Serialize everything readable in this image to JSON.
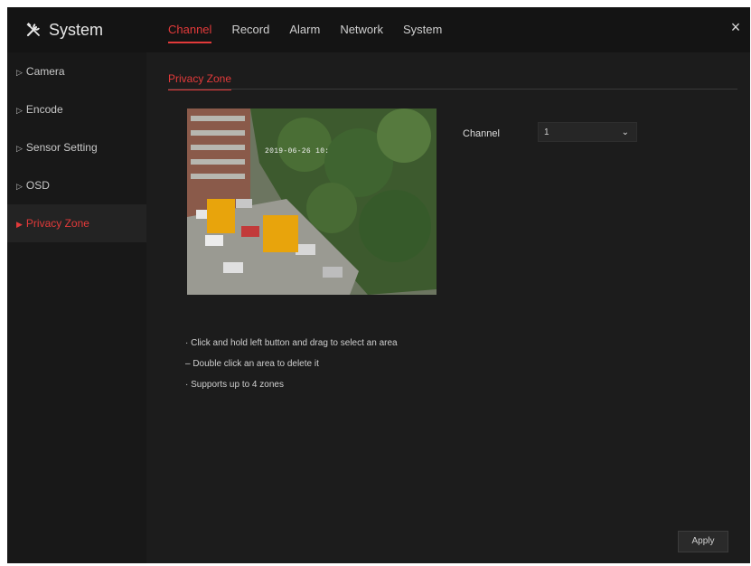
{
  "app": {
    "title": "System",
    "icon": "tools-icon",
    "close_label": "×"
  },
  "tabs": [
    {
      "label": "Channel",
      "active": true
    },
    {
      "label": "Record"
    },
    {
      "label": "Alarm"
    },
    {
      "label": "Network"
    },
    {
      "label": "System"
    }
  ],
  "sidebar": {
    "items": [
      {
        "label": "Camera"
      },
      {
        "label": "Encode"
      },
      {
        "label": "Sensor Setting"
      },
      {
        "label": "OSD"
      },
      {
        "label": "Privacy Zone",
        "active": true
      }
    ]
  },
  "main": {
    "subtab": "Privacy Zone",
    "preview": {
      "timestamp": "2019-06-26 10:"
    },
    "channel": {
      "label": "Channel",
      "value": "1"
    },
    "hints": [
      "· Click and hold left button and drag to select an area",
      "– Double click an area to delete it",
      "· Supports up to 4 zones"
    ],
    "apply_label": "Apply"
  },
  "colors": {
    "accent": "#e23a3a",
    "mask": "#e8a40c",
    "background": "#1c1c1c"
  }
}
